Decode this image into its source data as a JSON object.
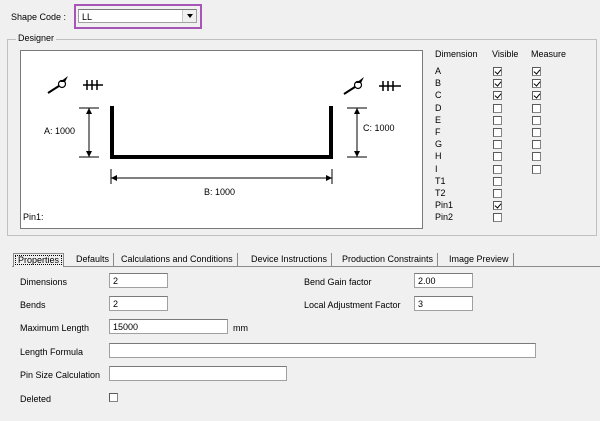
{
  "header": {
    "shape_code_label": "Shape Code :",
    "shape_code_value": "LL"
  },
  "designer": {
    "group_label": "Designer",
    "dims": {
      "a": "A: 1000",
      "b": "B: 1000",
      "c": "C: 1000"
    },
    "pin_label": "Pin1:",
    "headers": {
      "dimension": "Dimension",
      "visible": "Visible",
      "measure": "Measure"
    },
    "rows": [
      {
        "name": "A",
        "visible": true,
        "measure": true
      },
      {
        "name": "B",
        "visible": true,
        "measure": true
      },
      {
        "name": "C",
        "visible": true,
        "measure": true
      },
      {
        "name": "D",
        "visible": false,
        "measure": false
      },
      {
        "name": "E",
        "visible": false,
        "measure": false
      },
      {
        "name": "F",
        "visible": false,
        "measure": false
      },
      {
        "name": "G",
        "visible": false,
        "measure": false
      },
      {
        "name": "H",
        "visible": false,
        "measure": false
      },
      {
        "name": "I",
        "visible": false,
        "measure": false
      },
      {
        "name": "T1",
        "visible": false,
        "measure": null
      },
      {
        "name": "T2",
        "visible": false,
        "measure": null
      },
      {
        "name": "Pin1",
        "visible": true,
        "measure": null
      },
      {
        "name": "Pin2",
        "visible": false,
        "measure": null
      }
    ]
  },
  "tabs": [
    "Properties",
    "Defaults",
    "Calculations and Conditions",
    "Device Instructions",
    "Production Constraints",
    "Image Preview"
  ],
  "properties": {
    "dimensions_label": "Dimensions",
    "dimensions_value": "2",
    "bends_label": "Bends",
    "bends_value": "2",
    "max_length_label": "Maximum Length",
    "max_length_value": "15000",
    "max_length_unit": "mm",
    "length_formula_label": "Length Formula",
    "length_formula_value": "",
    "pin_size_label": "Pin Size Calculation",
    "pin_size_value": "",
    "deleted_label": "Deleted",
    "bend_gain_label": "Bend Gain factor",
    "bend_gain_value": "2.00",
    "local_adj_label": "Local Adjustment Factor",
    "local_adj_value": "3"
  },
  "colors": {
    "highlight": "#a855b8"
  }
}
